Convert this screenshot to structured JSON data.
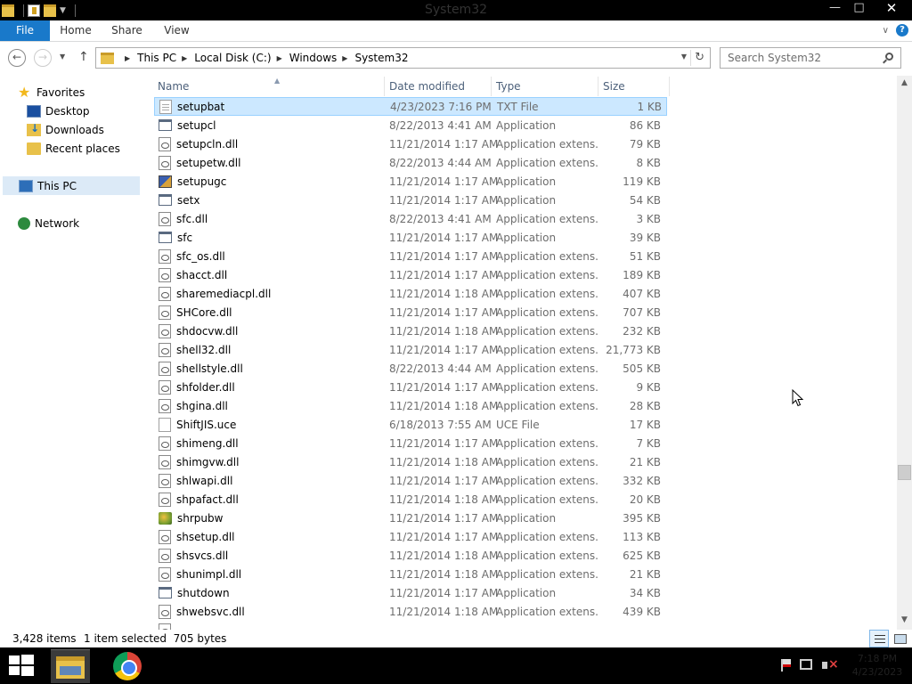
{
  "window": {
    "title": "System32",
    "minimize": "—",
    "maximize": "□",
    "close": "✕"
  },
  "ribbon": {
    "tabs": [
      "File",
      "Home",
      "Share",
      "View"
    ],
    "expand": "∨",
    "help": "?"
  },
  "address": {
    "breadcrumb": [
      "This PC",
      "Local Disk (C:)",
      "Windows",
      "System32"
    ],
    "back": "←",
    "forward": "→",
    "up": "↑",
    "refresh": "↻"
  },
  "search": {
    "placeholder": "Search System32"
  },
  "nav": {
    "favorites": "Favorites",
    "desktop": "Desktop",
    "downloads": "Downloads",
    "recent": "Recent places",
    "thispc": "This PC",
    "network": "Network"
  },
  "columns": {
    "name": "Name",
    "date": "Date modified",
    "type": "Type",
    "size": "Size"
  },
  "files": [
    {
      "name": "setupbat",
      "date": "4/23/2023 7:16 PM",
      "type": "TXT File",
      "size": "1 KB",
      "icon": "txt",
      "selected": true
    },
    {
      "name": "setupcl",
      "date": "8/22/2013 4:41 AM",
      "type": "Application",
      "size": "86 KB",
      "icon": "app"
    },
    {
      "name": "setupcln.dll",
      "date": "11/21/2014 1:17 AM",
      "type": "Application extens...",
      "size": "79 KB",
      "icon": "dll"
    },
    {
      "name": "setupetw.dll",
      "date": "8/22/2013 4:44 AM",
      "type": "Application extens...",
      "size": "8 KB",
      "icon": "dll"
    },
    {
      "name": "setupugc",
      "date": "11/21/2014 1:17 AM",
      "type": "Application",
      "size": "119 KB",
      "icon": "appcolor"
    },
    {
      "name": "setx",
      "date": "11/21/2014 1:17 AM",
      "type": "Application",
      "size": "54 KB",
      "icon": "app"
    },
    {
      "name": "sfc.dll",
      "date": "8/22/2013 4:41 AM",
      "type": "Application extens...",
      "size": "3 KB",
      "icon": "dll"
    },
    {
      "name": "sfc",
      "date": "11/21/2014 1:17 AM",
      "type": "Application",
      "size": "39 KB",
      "icon": "app"
    },
    {
      "name": "sfc_os.dll",
      "date": "11/21/2014 1:17 AM",
      "type": "Application extens...",
      "size": "51 KB",
      "icon": "dll"
    },
    {
      "name": "shacct.dll",
      "date": "11/21/2014 1:17 AM",
      "type": "Application extens...",
      "size": "189 KB",
      "icon": "dll"
    },
    {
      "name": "sharemediacpl.dll",
      "date": "11/21/2014 1:18 AM",
      "type": "Application extens...",
      "size": "407 KB",
      "icon": "dll"
    },
    {
      "name": "SHCore.dll",
      "date": "11/21/2014 1:17 AM",
      "type": "Application extens...",
      "size": "707 KB",
      "icon": "dll"
    },
    {
      "name": "shdocvw.dll",
      "date": "11/21/2014 1:18 AM",
      "type": "Application extens...",
      "size": "232 KB",
      "icon": "dll"
    },
    {
      "name": "shell32.dll",
      "date": "11/21/2014 1:17 AM",
      "type": "Application extens...",
      "size": "21,773 KB",
      "icon": "dll"
    },
    {
      "name": "shellstyle.dll",
      "date": "8/22/2013 4:44 AM",
      "type": "Application extens...",
      "size": "505 KB",
      "icon": "dll"
    },
    {
      "name": "shfolder.dll",
      "date": "11/21/2014 1:17 AM",
      "type": "Application extens...",
      "size": "9 KB",
      "icon": "dll"
    },
    {
      "name": "shgina.dll",
      "date": "11/21/2014 1:18 AM",
      "type": "Application extens...",
      "size": "28 KB",
      "icon": "dll"
    },
    {
      "name": "ShiftJIS.uce",
      "date": "6/18/2013 7:55 AM",
      "type": "UCE File",
      "size": "17 KB",
      "icon": "uce"
    },
    {
      "name": "shimeng.dll",
      "date": "11/21/2014 1:17 AM",
      "type": "Application extens...",
      "size": "7 KB",
      "icon": "dll"
    },
    {
      "name": "shimgvw.dll",
      "date": "11/21/2014 1:18 AM",
      "type": "Application extens...",
      "size": "21 KB",
      "icon": "dll"
    },
    {
      "name": "shlwapi.dll",
      "date": "11/21/2014 1:17 AM",
      "type": "Application extens...",
      "size": "332 KB",
      "icon": "dll"
    },
    {
      "name": "shpafact.dll",
      "date": "11/21/2014 1:18 AM",
      "type": "Application extens...",
      "size": "20 KB",
      "icon": "dll"
    },
    {
      "name": "shrpubw",
      "date": "11/21/2014 1:17 AM",
      "type": "Application",
      "size": "395 KB",
      "icon": "appshr"
    },
    {
      "name": "shsetup.dll",
      "date": "11/21/2014 1:17 AM",
      "type": "Application extens...",
      "size": "113 KB",
      "icon": "dll"
    },
    {
      "name": "shsvcs.dll",
      "date": "11/21/2014 1:18 AM",
      "type": "Application extens...",
      "size": "625 KB",
      "icon": "dll"
    },
    {
      "name": "shunimpl.dll",
      "date": "11/21/2014 1:18 AM",
      "type": "Application extens...",
      "size": "21 KB",
      "icon": "dll"
    },
    {
      "name": "shutdown",
      "date": "11/21/2014 1:17 AM",
      "type": "Application",
      "size": "34 KB",
      "icon": "app"
    },
    {
      "name": "shwebsvc.dll",
      "date": "11/21/2014 1:18 AM",
      "type": "Application extens...",
      "size": "439 KB",
      "icon": "dll"
    },
    {
      "name": "",
      "date": "",
      "type": "",
      "size": "",
      "icon": "dll"
    }
  ],
  "status": {
    "items": "3,428 items",
    "selection": "1 item selected  705 bytes"
  },
  "taskbar": {
    "clock_time": "7:18 PM",
    "clock_date": "4/23/2023"
  },
  "colors": {
    "accent": "#1979ca",
    "selection": "#cce8ff",
    "title_bar": "#000000",
    "taskbar": "#000000"
  }
}
